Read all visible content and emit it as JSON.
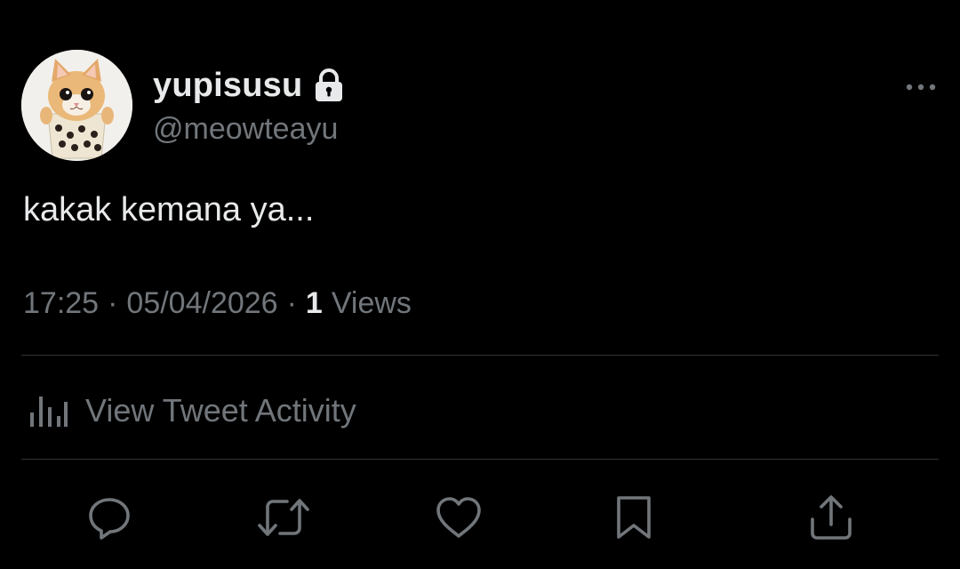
{
  "user": {
    "display_name": "yupisusu",
    "handle": "@meowteayu",
    "protected_icon": "lock-icon",
    "avatar": "cat-in-boba-cup avatar"
  },
  "tweet": {
    "text": "kakak kemana ya..."
  },
  "meta": {
    "time": "17:25",
    "separator": "·",
    "date": "05/04/2026",
    "views_count": "1",
    "views_label": "Views"
  },
  "activity": {
    "icon": "bar-chart-icon",
    "label": "View Tweet Activity"
  },
  "actions": [
    {
      "name": "reply",
      "icon": "reply-icon"
    },
    {
      "name": "retweet",
      "icon": "retweet-icon"
    },
    {
      "name": "like",
      "icon": "heart-icon"
    },
    {
      "name": "bookmark",
      "icon": "bookmark-icon"
    },
    {
      "name": "share",
      "icon": "share-icon"
    }
  ],
  "colors": {
    "background": "#000000",
    "primary_text": "#e7e9ea",
    "secondary_text": "#71767b",
    "divider": "#2f3336"
  }
}
